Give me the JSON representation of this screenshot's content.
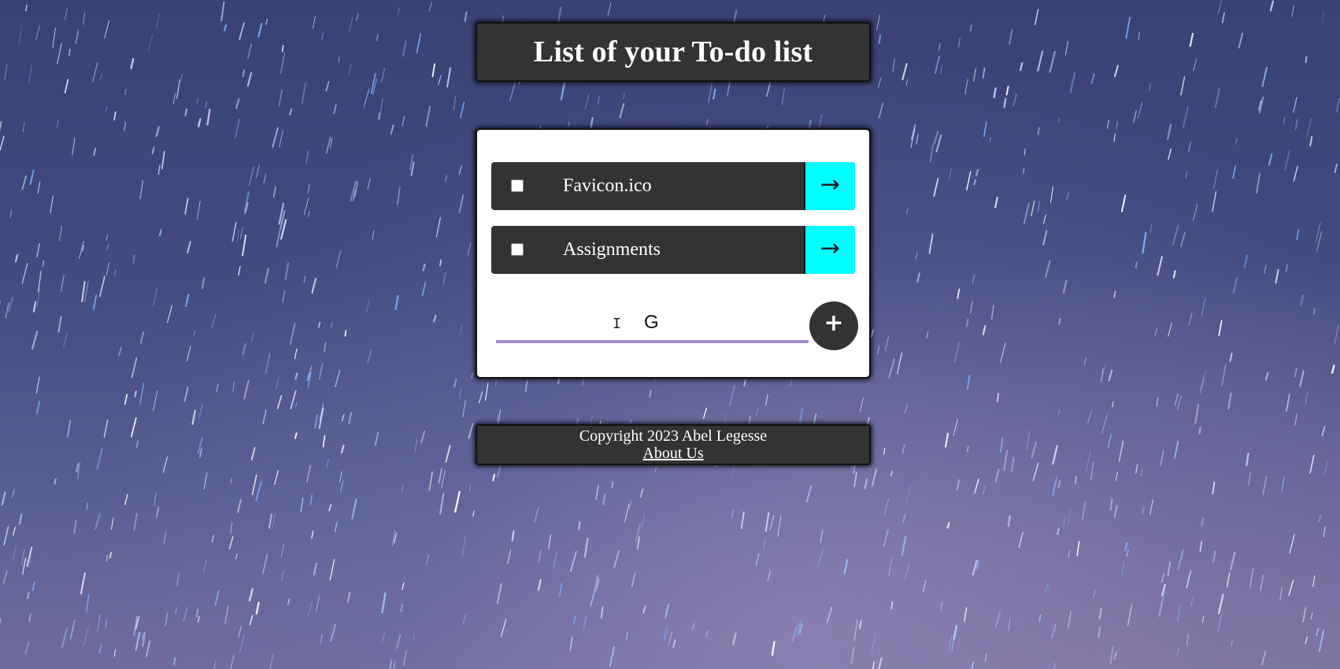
{
  "header": {
    "title": "List of your To-do list"
  },
  "tasks": [
    {
      "label": "Favicon.ico",
      "checked": false,
      "go_icon": "→"
    },
    {
      "label": "Assignments",
      "checked": false,
      "go_icon": "→"
    }
  ],
  "new_task_input": {
    "value": "G"
  },
  "add_button": {
    "icon": "+"
  },
  "footer": {
    "copyright": "Copyright 2023 Abel Legesse",
    "about_link": "About Us"
  },
  "colors": {
    "panel": "#333333",
    "go_button": "#00ffff",
    "input_underline": "#a58ad8"
  }
}
